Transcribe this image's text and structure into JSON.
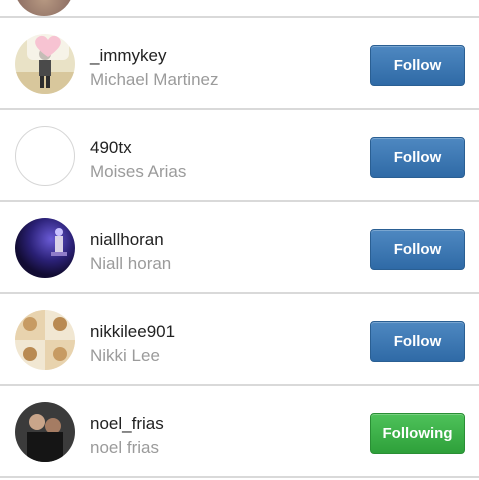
{
  "users": [
    {
      "username": "_immykey",
      "fullname": "Michael Martinez",
      "button": "Follow",
      "state": "follow"
    },
    {
      "username": "490tx",
      "fullname": "Moises Arias",
      "button": "Follow",
      "state": "follow"
    },
    {
      "username": "niallhoran",
      "fullname": "Niall horan",
      "button": "Follow",
      "state": "follow"
    },
    {
      "username": "nikkilee901",
      "fullname": "Nikki Lee",
      "button": "Follow",
      "state": "follow"
    },
    {
      "username": "noel_frias",
      "fullname": "noel frias",
      "button": "Following",
      "state": "following"
    }
  ],
  "colors": {
    "follow_button": "#3a75b0",
    "following_button": "#36a843",
    "divider": "#d9d9d9",
    "username_text": "#222222",
    "fullname_text": "#9b9b9b"
  }
}
